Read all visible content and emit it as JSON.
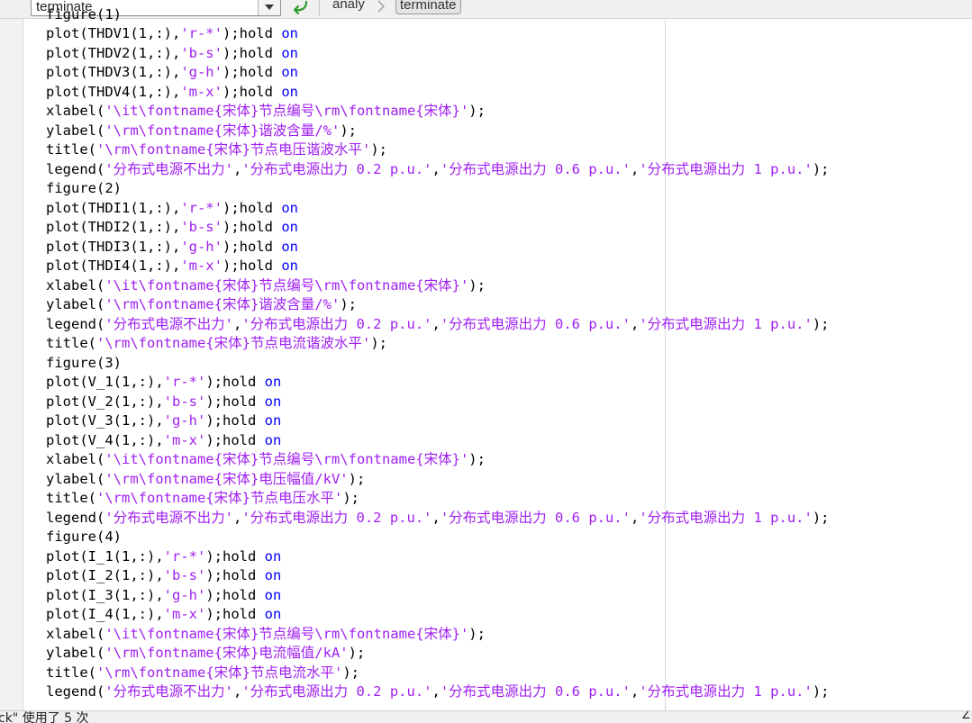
{
  "toolbar": {
    "function_dropdown_value": "terminate",
    "breadcrumb": [
      "analy",
      "terminate"
    ]
  },
  "code_lines": [
    [
      {
        "t": "figure(1)",
        "c": "plain"
      }
    ],
    [
      {
        "t": "plot(THDV1(1,:),",
        "c": "plain"
      },
      {
        "t": "'r-*'",
        "c": "str"
      },
      {
        "t": ");hold ",
        "c": "plain"
      },
      {
        "t": "on",
        "c": "kw"
      }
    ],
    [
      {
        "t": "plot(THDV2(1,:),",
        "c": "plain"
      },
      {
        "t": "'b-s'",
        "c": "str"
      },
      {
        "t": ");hold ",
        "c": "plain"
      },
      {
        "t": "on",
        "c": "kw"
      }
    ],
    [
      {
        "t": "plot(THDV3(1,:),",
        "c": "plain"
      },
      {
        "t": "'g-h'",
        "c": "str"
      },
      {
        "t": ");hold ",
        "c": "plain"
      },
      {
        "t": "on",
        "c": "kw"
      }
    ],
    [
      {
        "t": "plot(THDV4(1,:),",
        "c": "plain"
      },
      {
        "t": "'m-x'",
        "c": "str"
      },
      {
        "t": ");hold ",
        "c": "plain"
      },
      {
        "t": "on",
        "c": "kw"
      }
    ],
    [
      {
        "t": "xlabel(",
        "c": "plain"
      },
      {
        "t": "'\\it\\fontname{宋体}节点编号\\rm\\fontname{宋体}'",
        "c": "str"
      },
      {
        "t": ");",
        "c": "plain"
      }
    ],
    [
      {
        "t": "ylabel(",
        "c": "plain"
      },
      {
        "t": "'\\rm\\fontname{宋体}谐波含量/%'",
        "c": "str"
      },
      {
        "t": ");",
        "c": "plain"
      }
    ],
    [
      {
        "t": "title(",
        "c": "plain"
      },
      {
        "t": "'\\rm\\fontname{宋体}节点电压谐波水平'",
        "c": "str"
      },
      {
        "t": ");",
        "c": "plain"
      }
    ],
    [
      {
        "t": "legend(",
        "c": "plain"
      },
      {
        "t": "'分布式电源不出力'",
        "c": "str"
      },
      {
        "t": ",",
        "c": "plain"
      },
      {
        "t": "'分布式电源出力 0.2 p.u.'",
        "c": "str"
      },
      {
        "t": ",",
        "c": "plain"
      },
      {
        "t": "'分布式电源出力 0.6 p.u.'",
        "c": "str"
      },
      {
        "t": ",",
        "c": "plain"
      },
      {
        "t": "'分布式电源出力 1 p.u.'",
        "c": "str"
      },
      {
        "t": ");",
        "c": "plain"
      }
    ],
    [
      {
        "t": "figure(2)",
        "c": "plain"
      }
    ],
    [
      {
        "t": "plot(THDI1(1,:),",
        "c": "plain"
      },
      {
        "t": "'r-*'",
        "c": "str"
      },
      {
        "t": ");hold ",
        "c": "plain"
      },
      {
        "t": "on",
        "c": "kw"
      }
    ],
    [
      {
        "t": "plot(THDI2(1,:),",
        "c": "plain"
      },
      {
        "t": "'b-s'",
        "c": "str"
      },
      {
        "t": ");hold ",
        "c": "plain"
      },
      {
        "t": "on",
        "c": "kw"
      }
    ],
    [
      {
        "t": "plot(THDI3(1,:),",
        "c": "plain"
      },
      {
        "t": "'g-h'",
        "c": "str"
      },
      {
        "t": ");hold ",
        "c": "plain"
      },
      {
        "t": "on",
        "c": "kw"
      }
    ],
    [
      {
        "t": "plot(THDI4(1,:),",
        "c": "plain"
      },
      {
        "t": "'m-x'",
        "c": "str"
      },
      {
        "t": ");hold ",
        "c": "plain"
      },
      {
        "t": "on",
        "c": "kw"
      }
    ],
    [
      {
        "t": "xlabel(",
        "c": "plain"
      },
      {
        "t": "'\\it\\fontname{宋体}节点编号\\rm\\fontname{宋体}'",
        "c": "str"
      },
      {
        "t": ");",
        "c": "plain"
      }
    ],
    [
      {
        "t": "ylabel(",
        "c": "plain"
      },
      {
        "t": "'\\rm\\fontname{宋体}谐波含量/%'",
        "c": "str"
      },
      {
        "t": ");",
        "c": "plain"
      }
    ],
    [
      {
        "t": "legend(",
        "c": "plain"
      },
      {
        "t": "'分布式电源不出力'",
        "c": "str"
      },
      {
        "t": ",",
        "c": "plain"
      },
      {
        "t": "'分布式电源出力 0.2 p.u.'",
        "c": "str"
      },
      {
        "t": ",",
        "c": "plain"
      },
      {
        "t": "'分布式电源出力 0.6 p.u.'",
        "c": "str"
      },
      {
        "t": ",",
        "c": "plain"
      },
      {
        "t": "'分布式电源出力 1 p.u.'",
        "c": "str"
      },
      {
        "t": ");",
        "c": "plain"
      }
    ],
    [
      {
        "t": "title(",
        "c": "plain"
      },
      {
        "t": "'\\rm\\fontname{宋体}节点电流谐波水平'",
        "c": "str"
      },
      {
        "t": ");",
        "c": "plain"
      }
    ],
    [
      {
        "t": "figure(3)",
        "c": "plain"
      }
    ],
    [
      {
        "t": "plot(V_1(1,:),",
        "c": "plain"
      },
      {
        "t": "'r-*'",
        "c": "str"
      },
      {
        "t": ");hold ",
        "c": "plain"
      },
      {
        "t": "on",
        "c": "kw"
      }
    ],
    [
      {
        "t": "plot(V_2(1,:),",
        "c": "plain"
      },
      {
        "t": "'b-s'",
        "c": "str"
      },
      {
        "t": ");hold ",
        "c": "plain"
      },
      {
        "t": "on",
        "c": "kw"
      }
    ],
    [
      {
        "t": "plot(V_3(1,:),",
        "c": "plain"
      },
      {
        "t": "'g-h'",
        "c": "str"
      },
      {
        "t": ");hold ",
        "c": "plain"
      },
      {
        "t": "on",
        "c": "kw"
      }
    ],
    [
      {
        "t": "plot(V_4(1,:),",
        "c": "plain"
      },
      {
        "t": "'m-x'",
        "c": "str"
      },
      {
        "t": ");hold ",
        "c": "plain"
      },
      {
        "t": "on",
        "c": "kw"
      }
    ],
    [
      {
        "t": "xlabel(",
        "c": "plain"
      },
      {
        "t": "'\\it\\fontname{宋体}节点编号\\rm\\fontname{宋体}'",
        "c": "str"
      },
      {
        "t": ");",
        "c": "plain"
      }
    ],
    [
      {
        "t": "ylabel(",
        "c": "plain"
      },
      {
        "t": "'\\rm\\fontname{宋体}电压幅值/kV'",
        "c": "str"
      },
      {
        "t": ");",
        "c": "plain"
      }
    ],
    [
      {
        "t": "title(",
        "c": "plain"
      },
      {
        "t": "'\\rm\\fontname{宋体}节点电压水平'",
        "c": "str"
      },
      {
        "t": ");",
        "c": "plain"
      }
    ],
    [
      {
        "t": "legend(",
        "c": "plain"
      },
      {
        "t": "'分布式电源不出力'",
        "c": "str"
      },
      {
        "t": ",",
        "c": "plain"
      },
      {
        "t": "'分布式电源出力 0.2 p.u.'",
        "c": "str"
      },
      {
        "t": ",",
        "c": "plain"
      },
      {
        "t": "'分布式电源出力 0.6 p.u.'",
        "c": "str"
      },
      {
        "t": ",",
        "c": "plain"
      },
      {
        "t": "'分布式电源出力 1 p.u.'",
        "c": "str"
      },
      {
        "t": ");",
        "c": "plain"
      }
    ],
    [
      {
        "t": "figure(4)",
        "c": "plain"
      }
    ],
    [
      {
        "t": "plot(I_1(1,:),",
        "c": "plain"
      },
      {
        "t": "'r-*'",
        "c": "str"
      },
      {
        "t": ");hold ",
        "c": "plain"
      },
      {
        "t": "on",
        "c": "kw"
      }
    ],
    [
      {
        "t": "plot(I_2(1,:),",
        "c": "plain"
      },
      {
        "t": "'b-s'",
        "c": "str"
      },
      {
        "t": ");hold ",
        "c": "plain"
      },
      {
        "t": "on",
        "c": "kw"
      }
    ],
    [
      {
        "t": "plot(I_3(1,:),",
        "c": "plain"
      },
      {
        "t": "'g-h'",
        "c": "str"
      },
      {
        "t": ");hold ",
        "c": "plain"
      },
      {
        "t": "on",
        "c": "kw"
      }
    ],
    [
      {
        "t": "plot(I_4(1,:),",
        "c": "plain"
      },
      {
        "t": "'m-x'",
        "c": "str"
      },
      {
        "t": ");hold ",
        "c": "plain"
      },
      {
        "t": "on",
        "c": "kw"
      }
    ],
    [
      {
        "t": "xlabel(",
        "c": "plain"
      },
      {
        "t": "'\\it\\fontname{宋体}节点编号\\rm\\fontname{宋体}'",
        "c": "str"
      },
      {
        "t": ");",
        "c": "plain"
      }
    ],
    [
      {
        "t": "ylabel(",
        "c": "plain"
      },
      {
        "t": "'\\rm\\fontname{宋体}电流幅值/kA'",
        "c": "str"
      },
      {
        "t": ");",
        "c": "plain"
      }
    ],
    [
      {
        "t": "title(",
        "c": "plain"
      },
      {
        "t": "'\\rm\\fontname{宋体}节点电流水平'",
        "c": "str"
      },
      {
        "t": ");",
        "c": "plain"
      }
    ],
    [
      {
        "t": "legend(",
        "c": "plain"
      },
      {
        "t": "'分布式电源不出力'",
        "c": "str"
      },
      {
        "t": ",",
        "c": "plain"
      },
      {
        "t": "'分布式电源出力 0.2 p.u.'",
        "c": "str"
      },
      {
        "t": ",",
        "c": "plain"
      },
      {
        "t": "'分布式电源出力 0.6 p.u.'",
        "c": "str"
      },
      {
        "t": ",",
        "c": "plain"
      },
      {
        "t": "'分布式电源出力 1 p.u.'",
        "c": "str"
      },
      {
        "t": ");",
        "c": "plain"
      }
    ]
  ],
  "status_bar": {
    "text": "ck\" 使用了 5 次",
    "corner": "Z"
  },
  "colors": {
    "string": "#a020f0",
    "keyword": "#0000ff",
    "text": "#000000"
  }
}
